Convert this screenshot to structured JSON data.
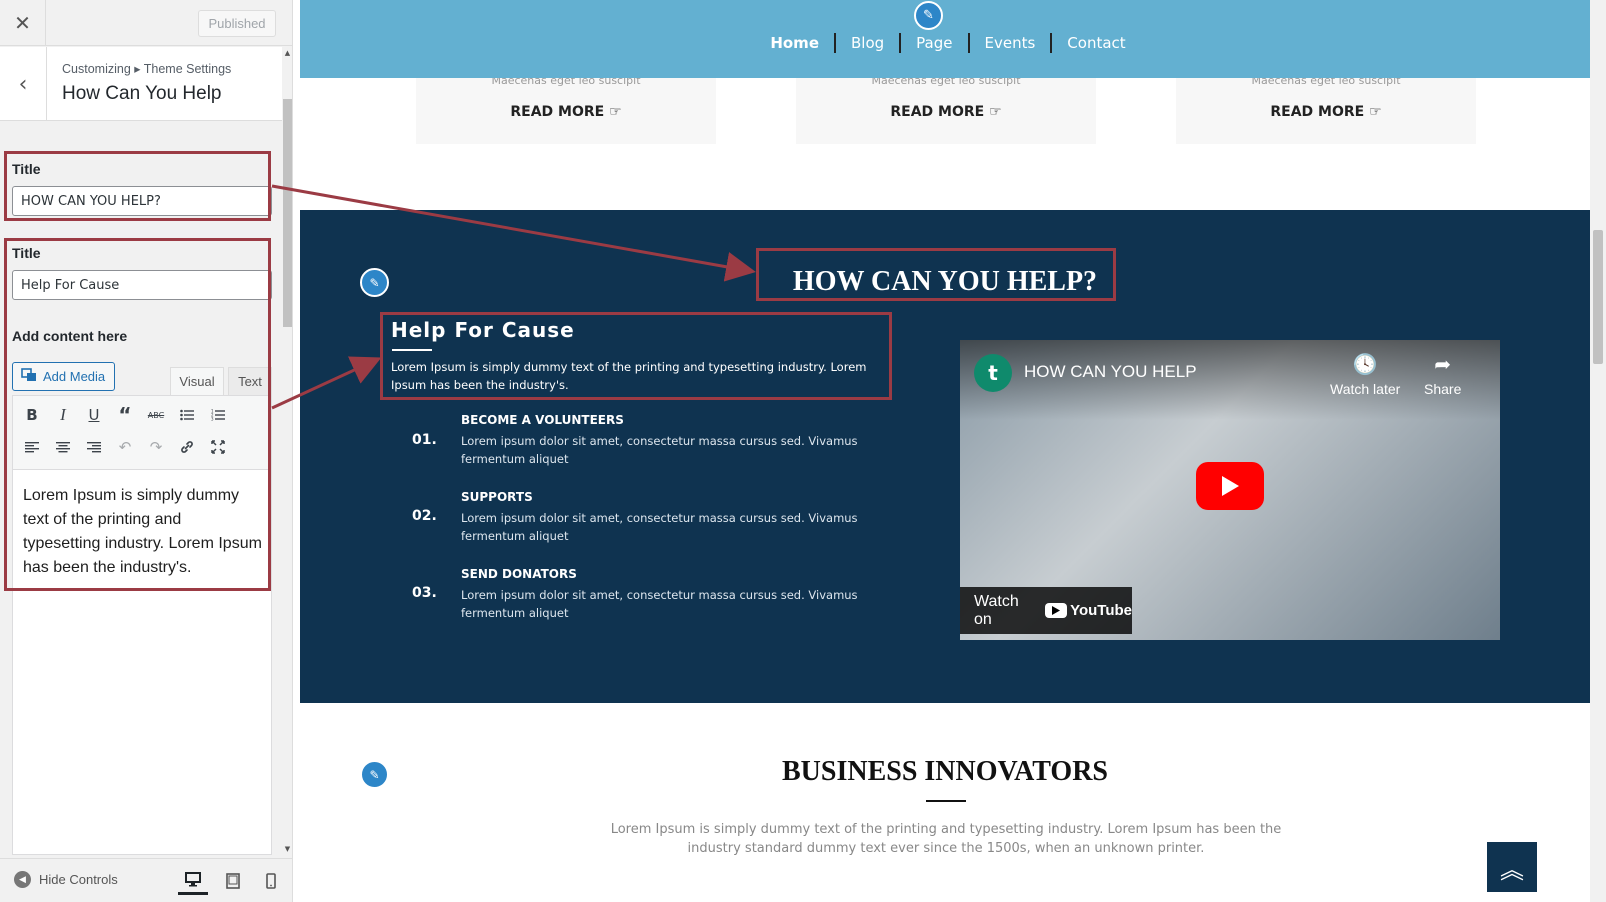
{
  "panel": {
    "close_glyph": "✕",
    "published_label": "Published",
    "back_glyph": "‹",
    "breadcrumb": "Customizing ▸ Theme Settings",
    "section_title": "How Can You Help",
    "fields": {
      "title1_label": "Title",
      "title1_value": "HOW CAN YOU HELP?",
      "title2_label": "Title",
      "title2_value": "Help For Cause",
      "content_label": "Add content here"
    },
    "editor": {
      "add_media_label": "Add Media",
      "tab_visual": "Visual",
      "tab_text": "Text",
      "toolbar": [
        "bold-icon",
        "italic-icon",
        "underline-icon",
        "blockquote-icon",
        "strikethrough-icon",
        "bullet-list-icon",
        "numbered-list-icon",
        "align-left-icon",
        "align-center-icon",
        "align-right-icon",
        "undo-icon",
        "redo-icon",
        "link-icon",
        "fullscreen-icon"
      ],
      "content": "Lorem Ipsum is simply dummy text of the printing and typesetting industry. Lorem Ipsum has been the industry's."
    },
    "footer": {
      "hide_controls_label": "Hide Controls",
      "devices": [
        "desktop-icon",
        "tablet-icon",
        "mobile-icon"
      ]
    }
  },
  "preview": {
    "nav": {
      "links": [
        "Home",
        "Blog",
        "Page",
        "Events",
        "Contact"
      ],
      "active": "Home"
    },
    "cards": {
      "subtitle": "Maecenas eget leo suscipit",
      "read_more": "READ MORE ☞"
    },
    "help": {
      "title": "HOW CAN YOU HELP?",
      "cause_title": "Help For Cause",
      "cause_text": "Lorem Ipsum is simply dummy text of the printing and typesetting industry. Lorem Ipsum has been the industry's.",
      "steps": [
        {
          "num": "01.",
          "title": "BECOME A VOLUNTEERS",
          "text": "Lorem ipsum dolor sit amet, consectetur massa cursus sed. Vivamus fermentum aliquet"
        },
        {
          "num": "02.",
          "title": "SUPPORTS",
          "text": "Lorem ipsum dolor sit amet, consectetur massa cursus sed. Vivamus fermentum aliquet"
        },
        {
          "num": "03.",
          "title": "SEND DONATORS",
          "text": "Lorem ipsum dolor sit amet, consectetur massa cursus sed. Vivamus fermentum aliquet"
        }
      ],
      "video": {
        "avatar_letter": "t",
        "title": "HOW CAN YOU HELP",
        "watch_later": "Watch later",
        "share": "Share",
        "watch_on": "Watch on",
        "youtube": "YouTube"
      }
    },
    "business": {
      "title": "BUSINESS INNOVATORS",
      "text": "Lorem Ipsum is simply dummy text of the printing and typesetting industry. Lorem Ipsum has been the industry standard dummy text ever since the 1500s, when an unknown printer."
    }
  },
  "colors": {
    "nav_bg": "#63b0d1",
    "section_bg": "#0f3350",
    "annotation": "#9b3b44",
    "edit_pin": "#2d86c8"
  }
}
